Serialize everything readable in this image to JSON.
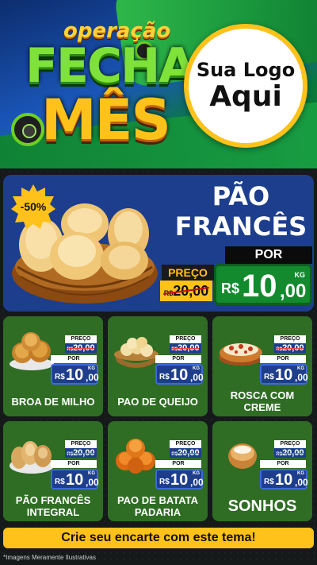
{
  "header": {
    "title_line1": "operação",
    "title_line2": "FECHA",
    "title_line3": "MÊS",
    "logo_line1": "Sua Logo",
    "logo_line2": "Aqui"
  },
  "hero": {
    "discount": "-50%",
    "name_line1": "PÃO",
    "name_line2": "FRANCÊS",
    "por_label": "POR",
    "preco_label": "PREÇO",
    "old_currency": "R$",
    "old_price": "20,00",
    "currency": "R$",
    "price_int": "10",
    "price_dec": ",00",
    "unit": "KG"
  },
  "cards": [
    {
      "name": "BROA DE MILHO",
      "preco_label": "PREÇO",
      "por_label": "POR",
      "old_currency": "R$",
      "old_price": "20,00",
      "currency": "R$",
      "price_int": "10",
      "price_dec": ",00",
      "unit": "KG",
      "image": "cornbread-icon"
    },
    {
      "name": "PAO DE QUEIJO",
      "preco_label": "PREÇO",
      "por_label": "POR",
      "old_currency": "R$",
      "old_price": "20,00",
      "currency": "R$",
      "price_int": "10",
      "price_dec": ",00",
      "unit": "KG",
      "image": "cheese-bread-icon"
    },
    {
      "name": "ROSCA COM CREME",
      "preco_label": "PREÇO",
      "por_label": "POR",
      "old_currency": "R$",
      "old_price": "20,00",
      "currency": "R$",
      "price_int": "10",
      "price_dec": ",00",
      "unit": "KG",
      "image": "cream-roll-icon"
    },
    {
      "name": "PÃO FRANCÊS INTEGRAL",
      "preco_label": "PREÇO",
      "por_label": "POR",
      "old_currency": "R$",
      "old_price": "20,00",
      "currency": "R$",
      "price_int": "10",
      "price_dec": ",00",
      "unit": "KG",
      "image": "wholegrain-bread-icon"
    },
    {
      "name": "PAO DE BATATA PADARIA",
      "preco_label": "PREÇO",
      "por_label": "POR",
      "old_currency": "R$",
      "old_price": "20,00",
      "currency": "R$",
      "price_int": "10",
      "price_dec": ",00",
      "unit": "KG",
      "image": "potato-bread-icon"
    },
    {
      "name": "SONHOS",
      "preco_label": "PREÇO",
      "por_label": "POR",
      "old_currency": "R$",
      "old_price": "20,00",
      "currency": "R$",
      "price_int": "10",
      "price_dec": ",00",
      "unit": "KG",
      "image": "sonho-donut-icon"
    }
  ],
  "footer": {
    "cta": "Crie seu encarte com este tema!",
    "disclaimer": "*Imagens Meramente Ilustrativas"
  },
  "colors": {
    "hero_blue": "#1c3e8c",
    "card_green": "#2f6d24",
    "accent_yellow": "#ffc21a",
    "price_green": "#138a2e"
  }
}
